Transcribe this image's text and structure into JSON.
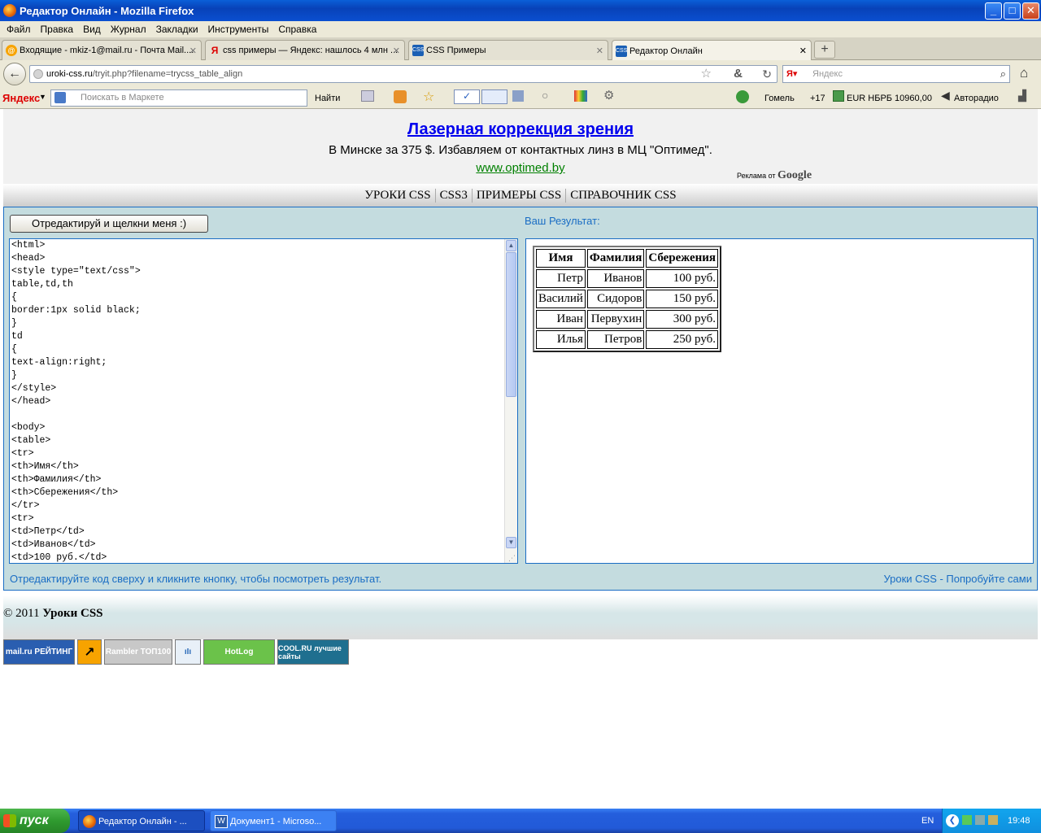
{
  "window": {
    "title": "Редактор Онлайн - Mozilla Firefox",
    "min": "_",
    "max": "□",
    "close": "✕"
  },
  "menu": [
    "Файл",
    "Правка",
    "Вид",
    "Журнал",
    "Закладки",
    "Инструменты",
    "Справка"
  ],
  "tabs": [
    {
      "label": "Входящие - mkiz-1@mail.ru - Почта Mail....",
      "icon": "@",
      "close": "✕"
    },
    {
      "label": "css примеры — Яндекс: нашлось 4 млн ...",
      "icon": "Я",
      "close": "✕"
    },
    {
      "label": "CSS Примеры",
      "icon": "CSS",
      "close": "✕"
    },
    {
      "label": "Редактор Онлайн",
      "icon": "CSS",
      "close": "✕"
    }
  ],
  "new_tab": "+",
  "nav": {
    "url_domain": "uroki-css.ru",
    "url_path": "/tryit.php?filename=trycss_table_align",
    "search_placeholder": "Яндекс",
    "back": "←"
  },
  "yandex_bar": {
    "logo": "Яндекс",
    "market_placeholder": "Поискать в Маркете",
    "find": "Найти",
    "city": "Гомель",
    "temp": "+17",
    "currency": "EUR НБРБ 10960,00",
    "radio": "Авторадио"
  },
  "ad": {
    "title": "Лазерная коррекция зрения",
    "text": "В Минске за 375 $. Избавляем от контактных линз в МЦ \"Оптимед\".",
    "link": "www.optimed.by",
    "by_label": "Реклама от",
    "google": "Google"
  },
  "topnav": [
    "УРОКИ CSS",
    "CSS3",
    "ПРИМЕРЫ CSS",
    "СПРАВОЧНИК CSS"
  ],
  "editor": {
    "run_button": "Отредактируй и щелкни меня :)",
    "result_title": "Ваш Результат:",
    "code": "<html>\n<head>\n<style type=\"text/css\">\ntable,td,th\n{\nborder:1px solid black;\n}\ntd\n{\ntext-align:right;\n}\n</style>\n</head>\n\n<body>\n<table>\n<tr>\n<th>Имя</th>\n<th>Фамилия</th>\n<th>Сбережения</th>\n</tr>\n<tr>\n<td>Петр</td>\n<td>Иванов</td>\n<td>100 руб.</td>",
    "footer_left": "Отредактируйте код сверху и кликните кнопку, чтобы посмотреть результат.",
    "footer_right": "Уроки CSS - Попробуйте сами"
  },
  "result_table": {
    "headers": [
      "Имя",
      "Фамилия",
      "Сбережения"
    ],
    "rows": [
      [
        "Петр",
        "Иванов",
        "100 руб."
      ],
      [
        "Василий",
        "Сидоров",
        "150 руб."
      ],
      [
        "Иван",
        "Первухин",
        "300 руб."
      ],
      [
        "Илья",
        "Петров",
        "250 руб."
      ]
    ]
  },
  "footer": {
    "copyright": "© 2011",
    "site": "Уроки CSS"
  },
  "counters": [
    {
      "label": "mail.ru РЕЙТИНГ",
      "bg": "#2a5eb0"
    },
    {
      "label": "↗",
      "bg": "#f7a300"
    },
    {
      "label": "Rambler ТОП100",
      "bg": "#c8c8c8"
    },
    {
      "label": "ıIı",
      "bg": "#e8f0f8"
    },
    {
      "label": "HotLog",
      "bg": "#6bc24a"
    },
    {
      "label": "COOL.RU лучшие сайты",
      "bg": "#1f6f8f"
    }
  ],
  "taskbar": {
    "start": "пуск",
    "items": [
      "Редактор Онлайн - ...",
      "Документ1 - Microso..."
    ],
    "lang": "EN",
    "time": "19:48"
  }
}
